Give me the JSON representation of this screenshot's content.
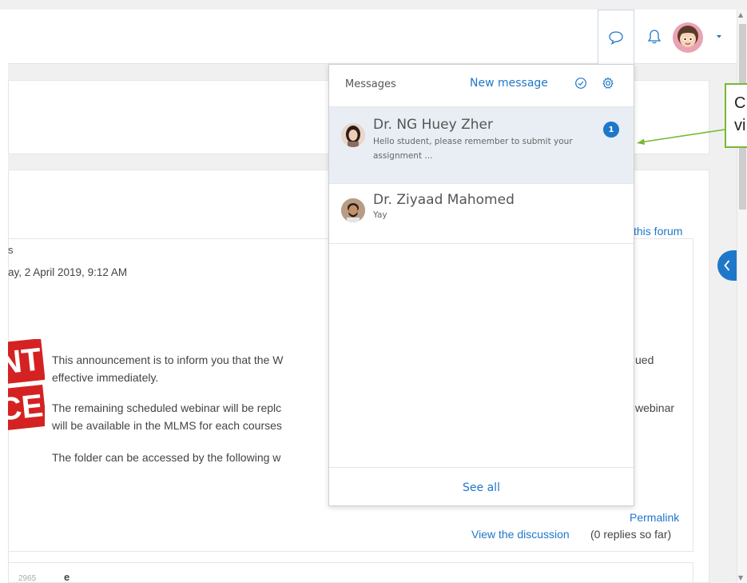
{
  "colors": {
    "accent": "#1f77c9",
    "callout_border": "#78b834",
    "stamp_red": "#d42222",
    "selected_row_bg": "#e8eef4"
  },
  "navbar": {
    "messages_icon": "chat-bubble-icon",
    "notifications_icon": "bell-icon",
    "user_menu_icon": "caret-down-icon"
  },
  "forum": {
    "subscribe_link": "this forum",
    "post_author_fragment": "s",
    "post_date": "ay, 2 April 2019, 9:12 AM",
    "stamp_line1": "NT",
    "stamp_line2": "CE",
    "body": [
      "This announcement is to inform you that the W",
      "effective immediately.",
      "The remaining scheduled webinar will be replc",
      "will be available in the MLMS for each courses",
      "The folder can be accessed by the following w"
    ],
    "body_right": [
      "ued",
      "webinar"
    ],
    "permalink": "Permalink",
    "view_discussion": "View the discussion",
    "replies": "(0 replies so far)",
    "next_post_number": "2965",
    "next_post_fragment": "e"
  },
  "messages": {
    "title": "Messages",
    "new_message": "New message",
    "mark_read_icon": "check-circle-icon",
    "settings_icon": "gear-icon",
    "conversations": [
      {
        "name": "Dr. NG Huey Zher",
        "preview": "Hello student, please remember to submit your assignment ...",
        "unread": "1"
      },
      {
        "name": "Dr. Ziyaad Mahomed",
        "preview": "Yay",
        "unread": ""
      }
    ],
    "see_all": "See all"
  },
  "callout": {
    "line1": "C",
    "line2": "vi"
  }
}
